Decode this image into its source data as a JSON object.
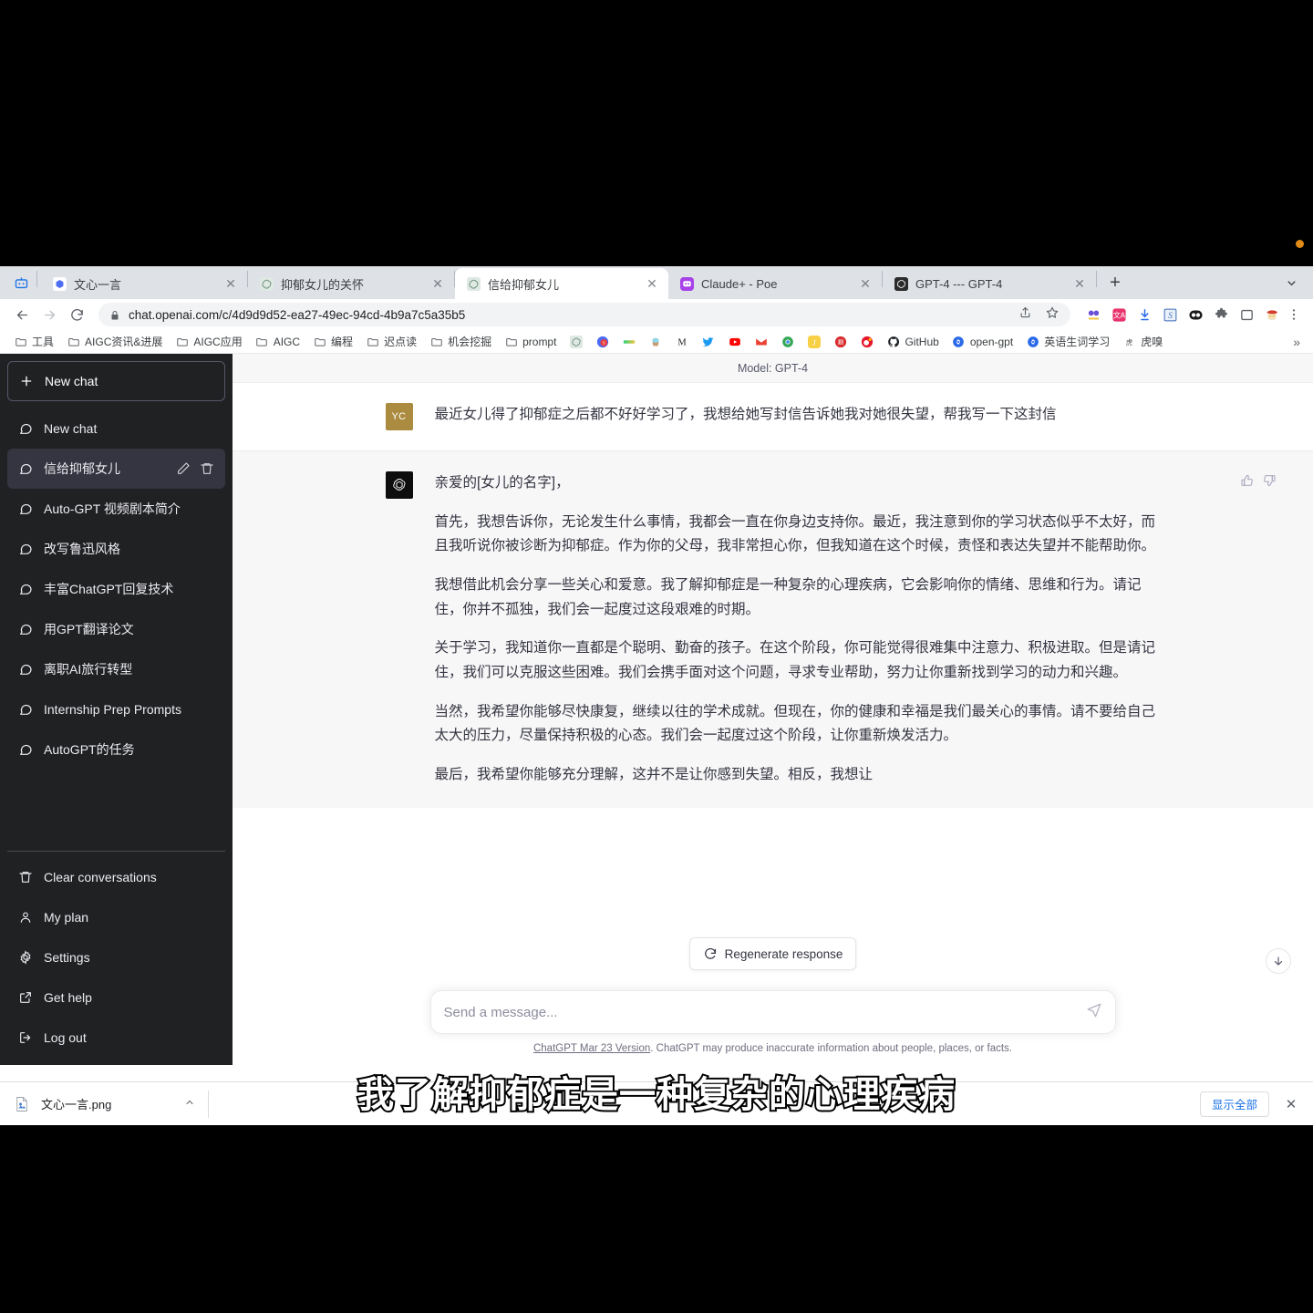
{
  "browser": {
    "app_badge_icon": "robot-icon",
    "tabs": [
      {
        "title": "文心一言",
        "favicon": "wenxin-icon",
        "active": false
      },
      {
        "title": "抑郁女儿的关怀",
        "favicon": "chatgpt-icon",
        "active": false
      },
      {
        "title": "信给抑郁女儿",
        "favicon": "chatgpt-icon",
        "active": true
      },
      {
        "title": "Claude+ - Poe",
        "favicon": "poe-icon",
        "active": false
      },
      {
        "title": "GPT-4 --- GPT-4",
        "favicon": "chatgpt-dark-icon",
        "active": false
      }
    ],
    "new_tab_label": "+",
    "tab_list_icon": "chevron-down-icon",
    "toolbar": {
      "back_icon": "back-arrow-icon",
      "forward_icon": "forward-arrow-icon",
      "reload_icon": "reload-icon",
      "lock_icon": "lock-icon",
      "url": "chat.openai.com/c/4d9d9d52-ea27-49ec-94cd-4b9a7c5a35b5",
      "share_icon": "share-icon",
      "bookmark_icon": "star-icon",
      "extensions": [
        "glasses-extension-icon",
        "translate-extension-icon",
        "download-extension-icon",
        "simpread-extension-icon",
        "dark-reader-extension-icon",
        "puzzle-extension-icon",
        "side-panel-icon",
        "avatar-extension-icon"
      ],
      "menu_icon": "kebab-menu-icon"
    },
    "bookmarks": [
      {
        "label": "工具",
        "icon": "folder-icon"
      },
      {
        "label": "AIGC资讯&进展",
        "icon": "folder-icon"
      },
      {
        "label": "AIGC应用",
        "icon": "folder-icon"
      },
      {
        "label": "AIGC",
        "icon": "folder-icon"
      },
      {
        "label": "编程",
        "icon": "folder-icon"
      },
      {
        "label": "迟点读",
        "icon": "folder-icon"
      },
      {
        "label": "机会挖掘",
        "icon": "folder-icon"
      },
      {
        "label": "prompt",
        "icon": "folder-icon"
      },
      {
        "label": "",
        "icon": "chatgpt-icon"
      },
      {
        "label": "",
        "icon": "red-circle-icon"
      },
      {
        "label": "",
        "icon": "gradient-icon"
      },
      {
        "label": "",
        "icon": "cupcake-icon"
      },
      {
        "label": "",
        "icon": "m-icon"
      },
      {
        "label": "",
        "icon": "twitter-icon"
      },
      {
        "label": "",
        "icon": "youtube-icon"
      },
      {
        "label": "",
        "icon": "gmail-icon"
      },
      {
        "label": "",
        "icon": "chrome-icon"
      },
      {
        "label": "",
        "icon": "juejin-icon"
      },
      {
        "label": "",
        "icon": "red-book-icon"
      },
      {
        "label": "",
        "icon": "weibo-icon"
      },
      {
        "label": "GitHub",
        "icon": "github-icon"
      },
      {
        "label": "open-gpt",
        "icon": "link-icon"
      },
      {
        "label": "英语生词学习",
        "icon": "link-icon"
      },
      {
        "label": "虎嗅",
        "icon": "huxiu-icon"
      }
    ],
    "bookmarks_overflow": "»"
  },
  "sidebar": {
    "new_chat": {
      "label": "New chat",
      "icon": "plus-icon"
    },
    "conversations": [
      {
        "label": "New chat",
        "icon": "message-icon",
        "active": false
      },
      {
        "label": "信给抑郁女儿",
        "icon": "message-icon",
        "active": true
      },
      {
        "label": "Auto-GPT 视频剧本简介",
        "icon": "message-icon",
        "active": false
      },
      {
        "label": "改写鲁迅风格",
        "icon": "message-icon",
        "active": false
      },
      {
        "label": "丰富ChatGPT回复技术",
        "icon": "message-icon",
        "active": false
      },
      {
        "label": "用GPT翻译论文",
        "icon": "message-icon",
        "active": false
      },
      {
        "label": "离职AI旅行转型",
        "icon": "message-icon",
        "active": false
      },
      {
        "label": "Internship Prep Prompts",
        "icon": "message-icon",
        "active": false
      },
      {
        "label": "AutoGPT的任务",
        "icon": "message-icon",
        "active": false
      }
    ],
    "conversation_actions": {
      "edit_icon": "pencil-icon",
      "delete_icon": "trash-icon"
    },
    "bottom_items": [
      {
        "label": "Clear conversations",
        "icon": "trash-icon"
      },
      {
        "label": "My plan",
        "icon": "person-icon"
      },
      {
        "label": "Settings",
        "icon": "gear-icon"
      },
      {
        "label": "Get help",
        "icon": "external-link-icon"
      },
      {
        "label": "Log out",
        "icon": "logout-icon"
      }
    ]
  },
  "chat": {
    "model_label": "Model: GPT-4",
    "user": {
      "avatar_initials": "YC",
      "avatar_color": "#ab8b40",
      "text": "最近女儿得了抑郁症之后都不好好学习了，我想给她写封信告诉她我对她很失望，帮我写一下这封信"
    },
    "assistant": {
      "avatar_icon": "openai-logo-icon",
      "avatar_color": "#0d0d0d",
      "paragraphs": [
        "亲爱的[女儿的名字]，",
        "首先，我想告诉你，无论发生什么事情，我都会一直在你身边支持你。最近，我注意到你的学习状态似乎不太好，而且我听说你被诊断为抑郁症。作为你的父母，我非常担心你，但我知道在这个时候，责怪和表达失望并不能帮助你。",
        "我想借此机会分享一些关心和爱意。我了解抑郁症是一种复杂的心理疾病，它会影响你的情绪、思维和行为。请记住，你并不孤独，我们会一起度过这段艰难的时期。",
        "关于学习，我知道你一直都是个聪明、勤奋的孩子。在这个阶段，你可能觉得很难集中注意力、积极进取。但是请记住，我们可以克服这些困难。我们会携手面对这个问题，寻求专业帮助，努力让你重新找到学习的动力和兴趣。",
        "当然，我希望你能够尽快康复，继续以往的学术成就。但现在，你的健康和幸福是我们最关心的事情。请不要给自己太大的压力，尽量保持积极的心态。我们会一起度过这个阶段，让你重新焕发活力。",
        "最后，我希望你能够充分理解，这并不是让你感到失望。相反，我想让"
      ],
      "thumbs_up_icon": "thumbs-up-icon",
      "thumbs_down_icon": "thumbs-down-icon"
    },
    "regenerate": {
      "label": "Regenerate response",
      "icon": "refresh-icon"
    },
    "scroll_down_icon": "arrow-down-icon",
    "composer": {
      "placeholder": "Send a message...",
      "send_icon": "send-icon"
    },
    "footnote_link": "ChatGPT Mar 23 Version",
    "footnote_rest": ". ChatGPT may produce inaccurate information about people, places, or facts."
  },
  "download_shelf": {
    "file_name": "文心一言.png",
    "file_icon": "image-file-icon",
    "expand_icon": "chevron-up-icon",
    "show_all_label": "显示全部",
    "close_icon": "close-icon"
  },
  "subtitle": {
    "text": "我了解抑郁症是一种复杂的心理疾病"
  },
  "recording_indicator": {
    "color": "#e08a17"
  }
}
